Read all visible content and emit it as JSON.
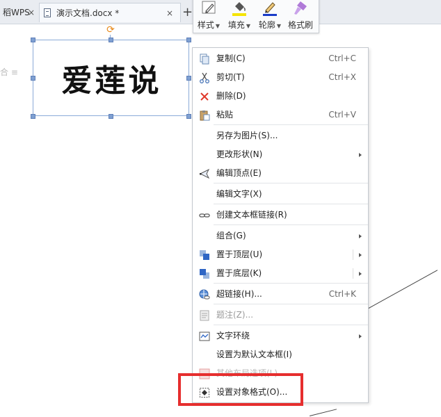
{
  "tabs": [
    {
      "label": "稻WPS",
      "close": "×"
    },
    {
      "label": "演示文档.docx *",
      "close": "×"
    }
  ],
  "new_tab_symbol": "+",
  "mini_toolbar": [
    {
      "label": "样式",
      "icon": "pen-style-icon"
    },
    {
      "label": "填充",
      "icon": "fill-bucket-icon"
    },
    {
      "label": "轮廓",
      "icon": "outline-pen-icon"
    },
    {
      "label": "格式刷",
      "icon": "format-painter-icon"
    }
  ],
  "left_margin_text": "合",
  "textbox": {
    "text": "爱莲说"
  },
  "context_menu": {
    "items": [
      {
        "label": "复制(C)",
        "shortcut": "Ctrl+C",
        "icon": "copy-icon"
      },
      {
        "label": "剪切(T)",
        "shortcut": "Ctrl+X",
        "icon": "scissors-icon"
      },
      {
        "label": "删除(D)",
        "shortcut": "",
        "icon": "delete-x-icon"
      },
      {
        "label": "粘贴",
        "shortcut": "Ctrl+V",
        "icon": "paste-icon"
      },
      {
        "label": "另存为图片(S)...",
        "shortcut": ""
      },
      {
        "label": "更改形状(N)",
        "shortcut": "",
        "submenu": true
      },
      {
        "label": "编辑顶点(E)",
        "shortcut": "",
        "icon": "edit-points-icon"
      },
      {
        "label": "编辑文字(X)",
        "shortcut": ""
      },
      {
        "label": "创建文本框链接(R)",
        "shortcut": "",
        "icon": "chain-link-icon"
      },
      {
        "label": "组合(G)",
        "shortcut": "",
        "submenu": true
      },
      {
        "label": "置于顶层(U)",
        "shortcut": "",
        "submenu": true,
        "icon": "bring-to-front-icon"
      },
      {
        "label": "置于底层(K)",
        "shortcut": "",
        "submenu": true,
        "icon": "send-to-back-icon"
      },
      {
        "label": "超链接(H)...",
        "shortcut": "Ctrl+K",
        "icon": "hyperlink-globe-icon"
      },
      {
        "label": "题注(Z)...",
        "shortcut": "",
        "disabled": true,
        "icon": "caption-icon"
      },
      {
        "label": "文字环绕",
        "shortcut": "",
        "submenu": true,
        "icon": "text-wrap-icon"
      },
      {
        "label": "设置为默认文本框(I)",
        "shortcut": ""
      },
      {
        "label": "其他布局选项(L)...",
        "shortcut": "",
        "icon": "layout-options-icon"
      },
      {
        "label": "设置对象格式(O)...",
        "shortcut": "",
        "icon": "format-object-icon"
      }
    ]
  },
  "colors": {
    "accent_highlight": "#e62e2e",
    "fill_yellow": "#f5e400",
    "outline_blue": "#1a3cc8",
    "painter_purple": "#b07ad8"
  }
}
